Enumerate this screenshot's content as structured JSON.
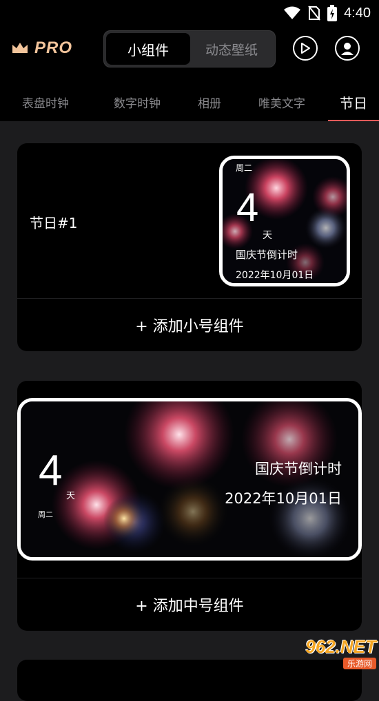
{
  "status": {
    "time": "4:40"
  },
  "header": {
    "pro_label": "PRO",
    "segments": [
      "小组件",
      "动态壁纸"
    ]
  },
  "tabs": [
    "表盘时钟",
    "数字时钟",
    "相册",
    "唯美文字",
    "节日"
  ],
  "card1": {
    "title": "节日#1",
    "widget": {
      "weekday": "周二",
      "count": "4",
      "unit": "天",
      "name": "国庆节倒计时",
      "date": "2022年10月01日"
    },
    "add_label": "+ 添加小号组件"
  },
  "card2": {
    "widget": {
      "count": "4",
      "unit": "天",
      "weekday": "周二",
      "name": "国庆节倒计时",
      "date": "2022年10月01日"
    },
    "add_label": "+ 添加中号组件"
  },
  "watermark": {
    "logo": "962.NET",
    "caption": "乐游网"
  },
  "colors": {
    "accent_pro": "#f2c49b",
    "tab_underline": "#e35a5a",
    "card_bg": "#000000",
    "page_bg": "#1c1c1e"
  }
}
